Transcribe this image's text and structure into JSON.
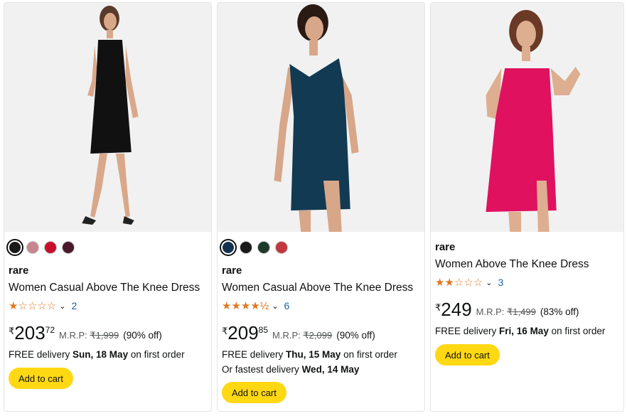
{
  "products": [
    {
      "colors": [
        "#1a1a1a",
        "#c7858f",
        "#c8102e",
        "#4a1a2c"
      ],
      "brand": "rare",
      "title": "Women Casual Above The Knee Dress",
      "stars": "★☆☆☆☆",
      "rating_value": 1.0,
      "review_count": "2",
      "price_currency": "₹",
      "price_whole": "203",
      "price_fraction": "72",
      "mrp_label": "M.R.P:",
      "mrp_value": "₹1,999",
      "discount": "(90% off)",
      "delivery_prefix": "FREE delivery",
      "delivery_date": "Sun, 18 May",
      "delivery_suffix": "on first order",
      "add_to_cart": "Add to cart",
      "dress_color": "#111111"
    },
    {
      "colors": [
        "#13324f",
        "#1a1a1a",
        "#1d3b2a",
        "#c0393f"
      ],
      "brand": "rare",
      "title": "Women Casual Above The Knee Dress",
      "stars": "★★★★½",
      "rating_value": 4.5,
      "review_count": "6",
      "price_currency": "₹",
      "price_whole": "209",
      "price_fraction": "85",
      "mrp_label": "M.R.P:",
      "mrp_value": "₹2,099",
      "discount": "(90% off)",
      "delivery_prefix": "FREE delivery",
      "delivery_date": "Thu, 15 May",
      "delivery_suffix": "on first order",
      "fastest_prefix": "Or fastest delivery",
      "fastest_date": "Wed, 14 May",
      "add_to_cart": "Add to cart",
      "dress_color": "#123a52"
    },
    {
      "brand": "rare",
      "title": "Women Above The Knee Dress",
      "stars": "★★☆☆☆",
      "rating_value": 2.0,
      "review_count": "3",
      "price_currency": "₹",
      "price_whole": "249",
      "mrp_label": "M.R.P:",
      "mrp_value": "₹1,499",
      "discount": "(83% off)",
      "delivery_prefix": "FREE delivery",
      "delivery_date": "Fri, 16 May",
      "delivery_suffix": "on first order",
      "add_to_cart": "Add to cart",
      "dress_color": "#e0115f"
    }
  ]
}
